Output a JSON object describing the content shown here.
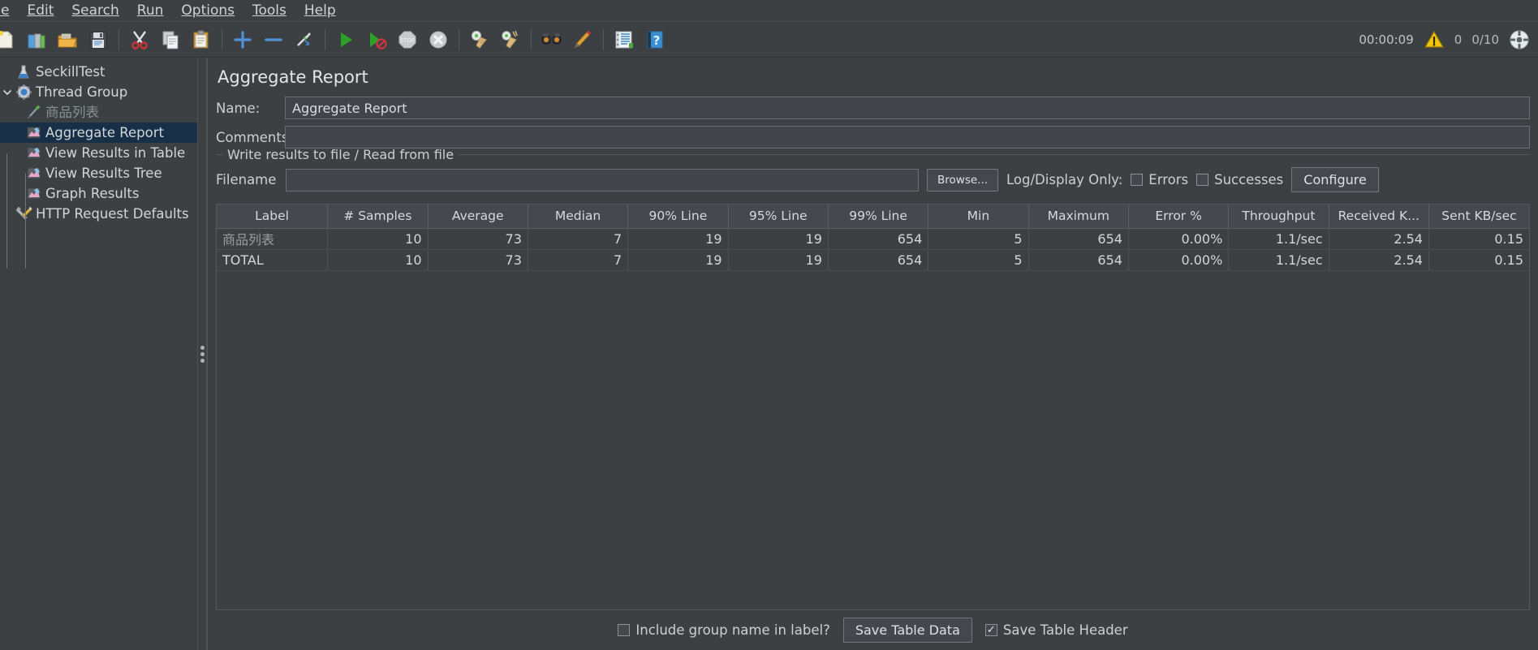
{
  "menu": {
    "items": [
      {
        "label": "File",
        "mnemonic": "F"
      },
      {
        "label": "Edit",
        "mnemonic": "E"
      },
      {
        "label": "Search",
        "mnemonic": "S"
      },
      {
        "label": "Run",
        "mnemonic": "R"
      },
      {
        "label": "Options",
        "mnemonic": "O"
      },
      {
        "label": "Tools",
        "mnemonic": "T"
      },
      {
        "label": "Help",
        "mnemonic": "H"
      }
    ]
  },
  "toolbar": {
    "buttons": [
      {
        "name": "new-icon",
        "title": "New"
      },
      {
        "name": "templates-icon",
        "title": "Templates"
      },
      {
        "name": "open-icon",
        "title": "Open"
      },
      {
        "name": "save-icon",
        "title": "Save"
      },
      {
        "name": "cut-icon",
        "title": "Cut"
      },
      {
        "name": "copy-icon",
        "title": "Copy"
      },
      {
        "name": "paste-icon",
        "title": "Paste"
      },
      {
        "name": "expand-all-icon",
        "title": "Expand All"
      },
      {
        "name": "collapse-all-icon",
        "title": "Collapse All"
      },
      {
        "name": "toggle-icon",
        "title": "Toggle"
      },
      {
        "name": "start-icon",
        "title": "Start"
      },
      {
        "name": "start-no-pauses-icon",
        "title": "Start no pauses"
      },
      {
        "name": "stop-icon",
        "title": "Stop"
      },
      {
        "name": "shutdown-icon",
        "title": "Shutdown"
      },
      {
        "name": "clear-icon",
        "title": "Clear"
      },
      {
        "name": "clear-all-icon",
        "title": "Clear All"
      },
      {
        "name": "search-icon",
        "title": "Search"
      },
      {
        "name": "reset-search-icon",
        "title": "Reset Search"
      },
      {
        "name": "function-helper-icon",
        "title": "Function Helper Dialog"
      },
      {
        "name": "help-icon",
        "title": "Help"
      }
    ]
  },
  "status": {
    "elapsed": "00:00:09",
    "warning_count": "0",
    "threads": "0/10",
    "connection_icon": "remote-connection-icon"
  },
  "tree": {
    "nodes": [
      {
        "label": "SeckillTest",
        "icon": "test-plan-icon",
        "depth": 0,
        "selected": false,
        "disabled": false,
        "expander": "none"
      },
      {
        "label": "Thread Group",
        "icon": "thread-group-icon",
        "depth": 0,
        "selected": false,
        "disabled": false,
        "expander": "expanded"
      },
      {
        "label": "商品列表",
        "icon": "http-sampler-icon",
        "depth": 1,
        "selected": false,
        "disabled": true,
        "expander": "none"
      },
      {
        "label": "Aggregate Report",
        "icon": "listener-icon",
        "depth": 1,
        "selected": true,
        "disabled": false,
        "expander": "none"
      },
      {
        "label": "View Results in Table",
        "icon": "listener-icon",
        "depth": 1,
        "selected": false,
        "disabled": false,
        "expander": "none"
      },
      {
        "label": "View Results Tree",
        "icon": "listener-icon",
        "depth": 1,
        "selected": false,
        "disabled": false,
        "expander": "none"
      },
      {
        "label": "Graph Results",
        "icon": "listener-icon",
        "depth": 1,
        "selected": false,
        "disabled": false,
        "expander": "none"
      },
      {
        "label": "HTTP Request Defaults",
        "icon": "config-element-icon",
        "depth": 0,
        "selected": false,
        "disabled": false,
        "expander": "none"
      }
    ]
  },
  "panel": {
    "title": "Aggregate Report",
    "name_label": "Name:",
    "name_value": "Aggregate Report",
    "comments_label": "Comments:",
    "comments_value": "",
    "group_legend": "Write results to file / Read from file",
    "filename_label": "Filename",
    "filename_value": "",
    "filename_placeholder": "",
    "browse_label": "Browse...",
    "log_display_label": "Log/Display Only:",
    "errors_label": "Errors",
    "errors_checked": false,
    "successes_label": "Successes",
    "successes_checked": false,
    "configure_label": "Configure"
  },
  "table": {
    "columns": [
      "Label",
      "# Samples",
      "Average",
      "Median",
      "90% Line",
      "95% Line",
      "99% Line",
      "Min",
      "Maximum",
      "Error %",
      "Throughput",
      "Received K...",
      "Sent KB/sec"
    ],
    "rows": [
      [
        "商品列表",
        "10",
        "73",
        "7",
        "19",
        "19",
        "654",
        "5",
        "654",
        "0.00%",
        "1.1/sec",
        "2.54",
        "0.15"
      ],
      [
        "TOTAL",
        "10",
        "73",
        "7",
        "19",
        "19",
        "654",
        "5",
        "654",
        "0.00%",
        "1.1/sec",
        "2.54",
        "0.15"
      ]
    ]
  },
  "bottom": {
    "include_group_label": "Include group name in label?",
    "include_group_checked": false,
    "save_table_data_label": "Save Table Data",
    "save_table_header_label": "Save Table Header",
    "save_table_header_checked": true
  },
  "colors": {
    "background": "#3c4043",
    "selection": "#173048",
    "text": "#d2d6d8",
    "disabled_text": "#8a8f92",
    "accent_blue": "#3b8ed0",
    "warning_yellow": "#f2c40c"
  }
}
